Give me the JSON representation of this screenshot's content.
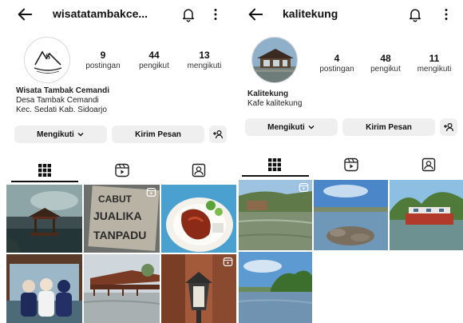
{
  "left": {
    "username": "wisatatambakce...",
    "stats": [
      {
        "value": "9",
        "label": "postingan"
      },
      {
        "value": "44",
        "label": "pengikut"
      },
      {
        "value": "13",
        "label": "mengikuti"
      }
    ],
    "bio": {
      "name": "Wisata Tambak Cemandi",
      "line1": "Desa Tambak Cemandi",
      "line2": "Kec. Sedati Kab. Sidoarjo"
    },
    "following_label": "Mengikuti",
    "message_label": "Kirim Pesan",
    "grid_sign_text": [
      "CABUT",
      "JUALIKA",
      "TANPADU"
    ]
  },
  "right": {
    "username": "kalitekung",
    "stats": [
      {
        "value": "4",
        "label": "postingan"
      },
      {
        "value": "48",
        "label": "pengikut"
      },
      {
        "value": "11",
        "label": "mengikuti"
      }
    ],
    "bio": {
      "name": "Kalitekung",
      "line1": "Kafe kalitekung"
    },
    "following_label": "Mengikuti",
    "message_label": "Kirim Pesan"
  },
  "colors": {
    "button_bg": "#efefef",
    "text": "#111111",
    "divider": "#dbdbdb"
  },
  "icons": [
    "back-arrow-icon",
    "bell-icon",
    "more-icon",
    "chevron-down-icon",
    "add-person-icon",
    "grid-icon",
    "reels-icon",
    "tagged-icon",
    "reel-badge-icon"
  ]
}
